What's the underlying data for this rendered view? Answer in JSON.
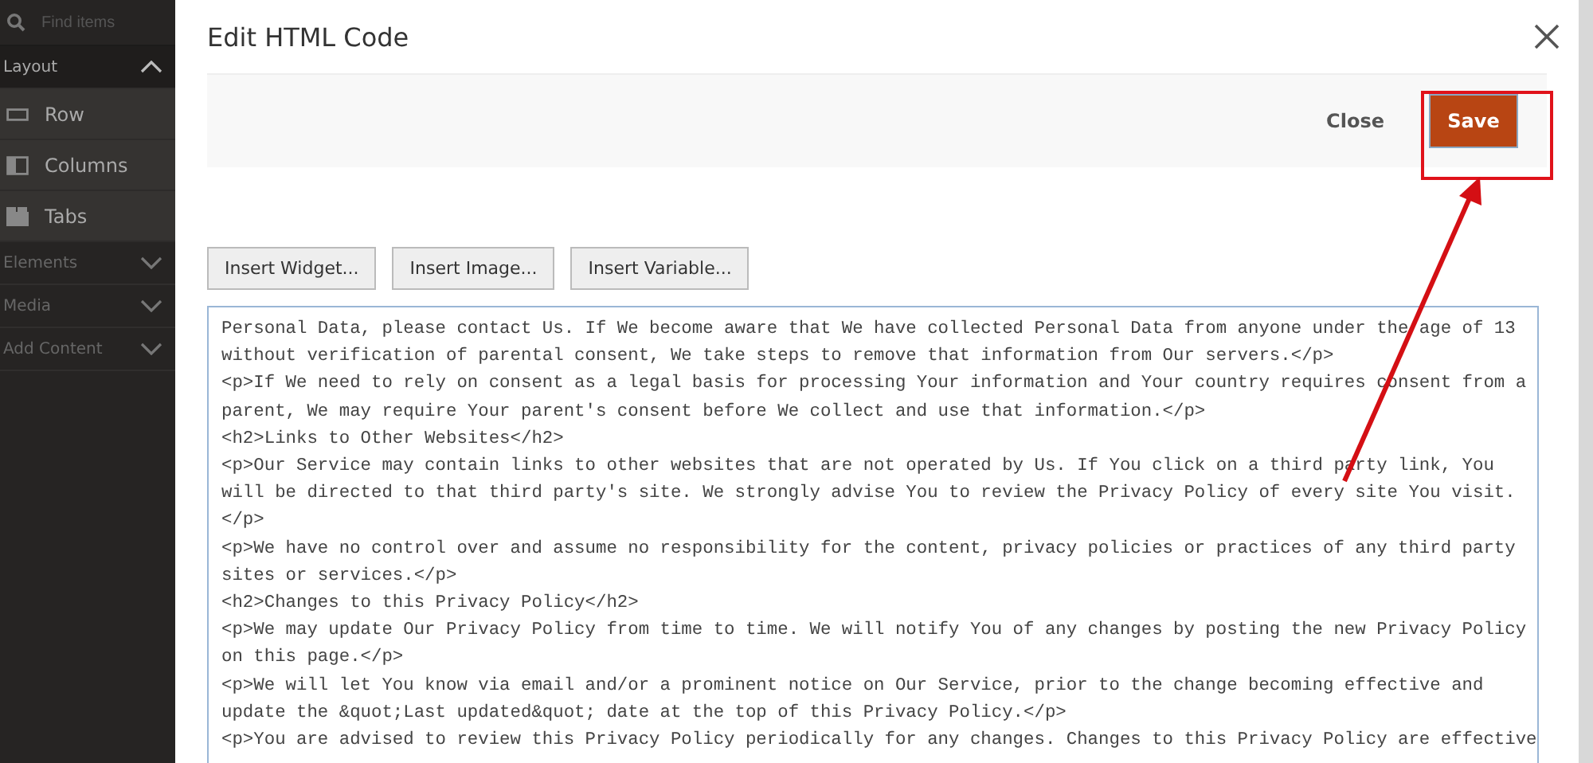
{
  "sidebar": {
    "search": {
      "placeholder": "Find items"
    },
    "sections": [
      {
        "label": "Layout",
        "expanded": true,
        "children": [
          {
            "label": "Row"
          },
          {
            "label": "Columns"
          },
          {
            "label": "Tabs"
          }
        ]
      },
      {
        "label": "Elements",
        "expanded": false
      },
      {
        "label": "Media",
        "expanded": false
      },
      {
        "label": "Add Content",
        "expanded": false
      }
    ]
  },
  "modal": {
    "title": "Edit HTML Code",
    "actions": [
      {
        "label": "Close",
        "kind": "secondary"
      },
      {
        "label": "Save",
        "kind": "primary"
      }
    ],
    "insert_buttons": [
      "Insert Widget...",
      "Insert Image...",
      "Insert Variable..."
    ],
    "editor_lines": [
      "Personal Data, please contact Us. If We become aware that We have collected Personal Data from anyone under the age of 13",
      "without verification of parental consent, We take steps to remove that information from Our servers.</p>",
      "<p>If We need to rely on consent as a legal basis for processing Your information and Your country requires consent from a",
      "parent, We may require Your parent's consent before We collect and use that information.</p>",
      "<h2>Links to Other Websites</h2>",
      "<p>Our Service may contain links to other websites that are not operated by Us. If You click on a third party link, You",
      "will be directed to that third party's site. We strongly advise You to review the Privacy Policy of every site You visit.",
      "</p>",
      "<p>We have no control over and assume no responsibility for the content, privacy policies or practices of any third party",
      "sites or services.</p>",
      "<h2>Changes to this Privacy Policy</h2>",
      "<p>We may update Our Privacy Policy from time to time. We will notify You of any changes by posting the new Privacy Policy",
      "on this page.</p>",
      "<p>We will let You know via email and/or a prominent notice on Our Service, prior to the change becoming effective and",
      "update the &quot;Last updated&quot; date at the top of this Privacy Policy.</p>",
      "<p>You are advised to review this Privacy Policy periodically for any changes. Changes to this Privacy Policy are effective"
    ]
  }
}
